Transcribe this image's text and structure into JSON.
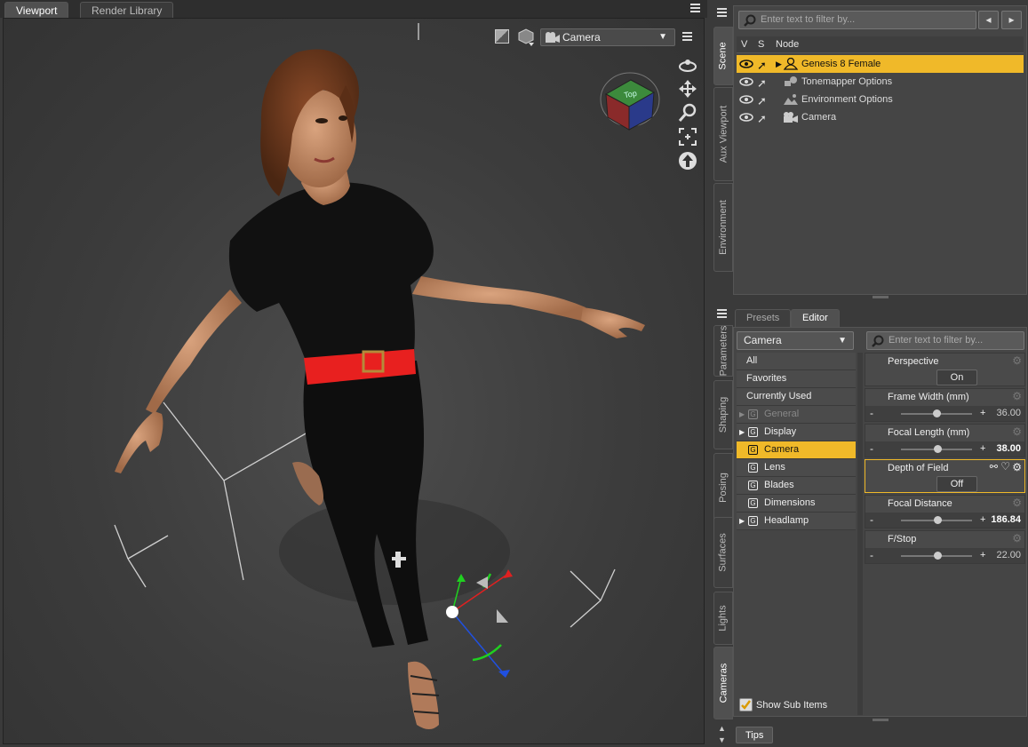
{
  "viewport_tabs": [
    {
      "label": "Viewport",
      "active": true
    },
    {
      "label": "Render Library",
      "active": false
    }
  ],
  "viewport": {
    "camera_select": "Camera",
    "view_cube_label": "Top",
    "nav_icons": [
      "orbit-icon",
      "pan-icon",
      "zoom-icon",
      "frame-icon",
      "up-icon"
    ]
  },
  "side_tabs": [
    {
      "label": "Scene",
      "active": true
    },
    {
      "label": "Aux Viewport",
      "active": false
    },
    {
      "label": "Environment",
      "active": false
    },
    {
      "label": "Parameters",
      "active": false
    },
    {
      "label": "Shaping",
      "active": false
    },
    {
      "label": "Posing",
      "active": false
    },
    {
      "label": "Surfaces",
      "active": false
    },
    {
      "label": "Lights",
      "active": false
    },
    {
      "label": "Cameras",
      "active": true
    }
  ],
  "scene": {
    "filter_placeholder": "Enter text to filter by...",
    "columns": {
      "v": "V",
      "s": "S",
      "node": "Node"
    },
    "nodes": [
      {
        "label": "Genesis 8 Female",
        "selected": true,
        "icon": "figure-icon"
      },
      {
        "label": "Tonemapper Options",
        "selected": false,
        "icon": "tonemapper-icon"
      },
      {
        "label": "Environment Options",
        "selected": false,
        "icon": "environment-icon"
      },
      {
        "label": "Camera",
        "selected": false,
        "icon": "camera-icon"
      }
    ]
  },
  "editor": {
    "tabs": [
      {
        "label": "Presets",
        "active": false
      },
      {
        "label": "Editor",
        "active": true
      }
    ],
    "node_select": "Camera",
    "filter_placeholder": "Enter text to filter by...",
    "categories": [
      {
        "label": "All",
        "group": false,
        "expand": false,
        "selected": false,
        "dim": false
      },
      {
        "label": "Favorites",
        "group": false,
        "expand": false,
        "selected": false,
        "dim": false
      },
      {
        "label": "Currently Used",
        "group": false,
        "expand": false,
        "selected": false,
        "dim": false
      },
      {
        "label": "General",
        "group": true,
        "expand": true,
        "selected": false,
        "dim": true
      },
      {
        "label": "Display",
        "group": true,
        "expand": true,
        "selected": false,
        "dim": false
      },
      {
        "label": "Camera",
        "group": true,
        "expand": false,
        "selected": true,
        "dim": false
      },
      {
        "label": "Lens",
        "group": true,
        "expand": false,
        "selected": false,
        "dim": false
      },
      {
        "label": "Blades",
        "group": true,
        "expand": false,
        "selected": false,
        "dim": false
      },
      {
        "label": "Dimensions",
        "group": true,
        "expand": false,
        "selected": false,
        "dim": false
      },
      {
        "label": "Headlamp",
        "group": true,
        "expand": true,
        "selected": false,
        "dim": false
      }
    ],
    "properties": [
      {
        "label": "Perspective",
        "kind": "toggle",
        "value": "On",
        "highlight": false
      },
      {
        "label": "Frame Width (mm)",
        "kind": "slider",
        "value": "36.00",
        "level": 0.5,
        "bold": false,
        "highlight": false
      },
      {
        "label": "Focal Length (mm)",
        "kind": "slider",
        "value": "38.00",
        "level": 0.52,
        "bold": true,
        "highlight": false
      },
      {
        "label": "Depth of Field",
        "kind": "toggle",
        "value": "Off",
        "highlight": true
      },
      {
        "label": "Focal Distance",
        "kind": "slider",
        "value": "186.84",
        "level": 0.52,
        "bold": true,
        "highlight": false
      },
      {
        "label": "F/Stop",
        "kind": "slider",
        "value": "22.00",
        "level": 0.52,
        "bold": false,
        "highlight": false
      }
    ],
    "show_sub_items": "Show Sub Items"
  },
  "bottom_tab": "Tips"
}
